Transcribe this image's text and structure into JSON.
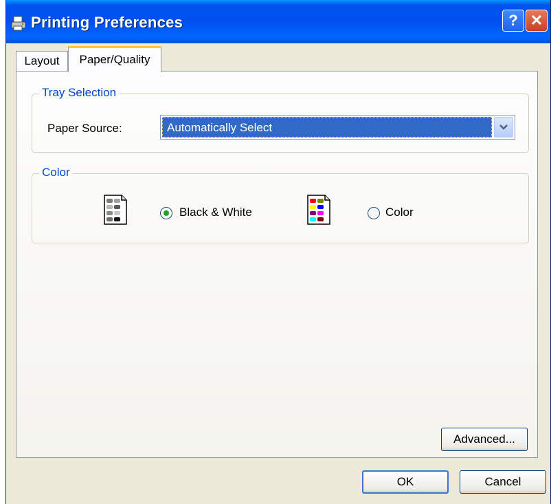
{
  "window": {
    "title": "Printing Preferences",
    "help_button": "?",
    "close_button": "✕"
  },
  "tabs": [
    {
      "label": "Layout",
      "selected": false
    },
    {
      "label": "Paper/Quality",
      "selected": true
    }
  ],
  "tray_selection": {
    "legend": "Tray Selection",
    "paper_source_label": "Paper Source:",
    "paper_source_value": "Automatically Select"
  },
  "color_group": {
    "legend": "Color",
    "options": [
      {
        "label": "Black & White",
        "selected": true,
        "icon": "grayscale-page-icon"
      },
      {
        "label": "Color",
        "selected": false,
        "icon": "color-page-icon"
      }
    ]
  },
  "buttons": {
    "advanced": "Advanced...",
    "ok": "OK",
    "cancel": "Cancel"
  },
  "colors": {
    "titlebar": "#0054e3",
    "legend_text": "#0046d5",
    "selection": "#316ac5",
    "active_tab_accent": "#ffc83c",
    "close_button": "#d4512d"
  }
}
